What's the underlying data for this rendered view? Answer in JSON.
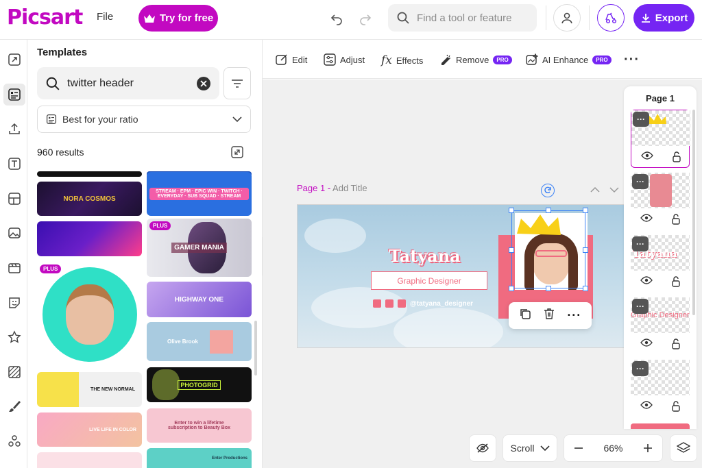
{
  "app": {
    "logo": "Picsart",
    "file_menu": "File",
    "try_label": "Try for free",
    "search_placeholder": "Find a tool or feature",
    "export_label": "Export"
  },
  "colors": {
    "brand": "#c209c1",
    "accent": "#7525f3",
    "design_pink": "#f06b80"
  },
  "panel": {
    "title": "Templates",
    "search_value": "twitter header",
    "ratio_label": "Best for your ratio",
    "results": "960 results",
    "templates": [
      {
        "text": "NORA COSMOS"
      },
      {
        "text": "STREAM · EPM · EPIC WIN · TWITCH · EVERYDAY · SUB SQUAD · STREAM"
      },
      {
        "text": ""
      },
      {
        "text": "GAMER MANIA",
        "badge": "PLUS"
      },
      {
        "text": "",
        "badge": "PLUS"
      },
      {
        "text": "HIGHWAY ONE"
      },
      {
        "text": "Olive Brook"
      },
      {
        "text": "THE NEW NORMAL"
      },
      {
        "text": "PHOTOGRID"
      },
      {
        "text": "LIVE LIFE IN COLOR"
      },
      {
        "text": "Enter to win a lifetime subscription to Beauty Box"
      },
      {
        "text": "Enter Productions"
      }
    ]
  },
  "toolbar": {
    "edit": "Edit",
    "adjust": "Adjust",
    "effects": "Effects",
    "remove": "Remove",
    "ai_enhance": "AI Enhance",
    "pro_badge": "PRO"
  },
  "canvas": {
    "page_label": "Page 1",
    "separator": " - ",
    "add_title": "Add Title",
    "design": {
      "name": "Tatyana",
      "role": "Graphic Designer",
      "handle": "@tatyana_designer"
    }
  },
  "pages_panel": {
    "title": "Page 1",
    "layers": [
      {
        "name": "crown-layer"
      },
      {
        "name": "photo-layer"
      },
      {
        "name": "name-text-layer",
        "preview": "Tatyana"
      },
      {
        "name": "role-text-layer",
        "preview": "Graphic Designer"
      },
      {
        "name": "handle-text-layer",
        "preview": ""
      }
    ]
  },
  "bottom": {
    "scroll_label": "Scroll",
    "zoom": "66%"
  },
  "icons": [
    "undo-icon",
    "redo-icon",
    "search-icon",
    "user-icon",
    "delivery-icon",
    "download-icon",
    "resize-icon",
    "templates-icon",
    "upload-icon",
    "text-icon",
    "layout-icon",
    "photo-icon",
    "video-icon",
    "sticker-icon",
    "star-icon",
    "pattern-icon",
    "brush-icon",
    "apps-icon",
    "clear-icon",
    "filter-icon",
    "chevron-down-icon",
    "expand-icon",
    "collapse-icon",
    "refresh-icon",
    "duplicate-icon",
    "trash-icon",
    "more-icon",
    "eye-icon",
    "lock-icon",
    "hide-icon",
    "minus-icon",
    "plus-icon",
    "layers-icon"
  ]
}
